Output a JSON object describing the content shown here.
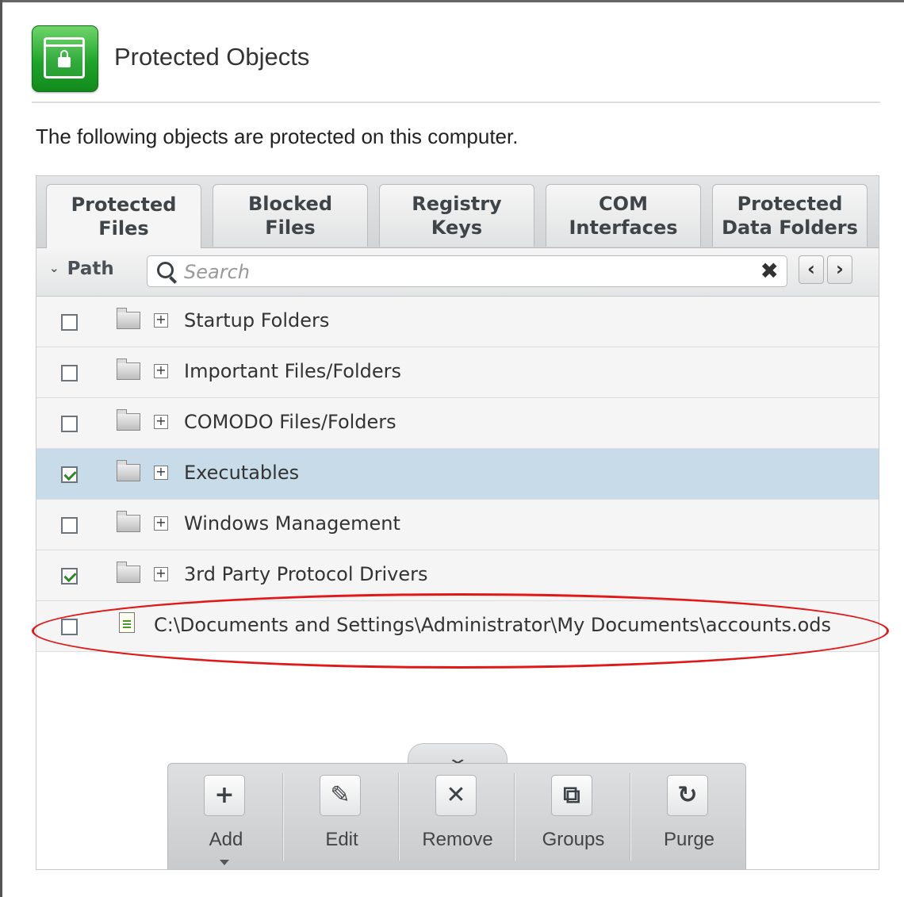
{
  "header": {
    "title": "Protected Objects",
    "description": "The following objects are protected on this computer."
  },
  "tabs": [
    {
      "label": "Protected\nFiles",
      "active": true
    },
    {
      "label": "Blocked\nFiles",
      "active": false
    },
    {
      "label": "Registry\nKeys",
      "active": false
    },
    {
      "label": "COM\nInterfaces",
      "active": false
    },
    {
      "label": "Protected\nData Folders",
      "active": false
    }
  ],
  "search": {
    "column_label": "Path",
    "placeholder": "Search",
    "value": ""
  },
  "rows": [
    {
      "label": "Startup Folders",
      "checked": false,
      "type": "group",
      "selected": false
    },
    {
      "label": "Important Files/Folders",
      "checked": false,
      "type": "group",
      "selected": false
    },
    {
      "label": "COMODO Files/Folders",
      "checked": false,
      "type": "group",
      "selected": false
    },
    {
      "label": "Executables",
      "checked": true,
      "type": "group",
      "selected": true
    },
    {
      "label": "Windows Management",
      "checked": false,
      "type": "group",
      "selected": false
    },
    {
      "label": "3rd Party Protocol Drivers",
      "checked": true,
      "type": "group",
      "selected": false
    },
    {
      "label": "C:\\Documents and Settings\\Administrator\\My Documents\\accounts.ods",
      "checked": false,
      "type": "file",
      "selected": false
    }
  ],
  "toolbar": {
    "items": [
      {
        "label": "Add",
        "icon": "plus-icon",
        "glyph": "+"
      },
      {
        "label": "Edit",
        "icon": "pencil-icon",
        "glyph": "✎"
      },
      {
        "label": "Remove",
        "icon": "x-icon",
        "glyph": "✕"
      },
      {
        "label": "Groups",
        "icon": "groups-icon",
        "glyph": "⧉"
      },
      {
        "label": "Purge",
        "icon": "purge-icon",
        "glyph": "↻"
      }
    ]
  },
  "colors": {
    "accent_green": "#1fa52b",
    "selected_row": "#c8dbe8",
    "highlight_ring": "#e01818"
  }
}
